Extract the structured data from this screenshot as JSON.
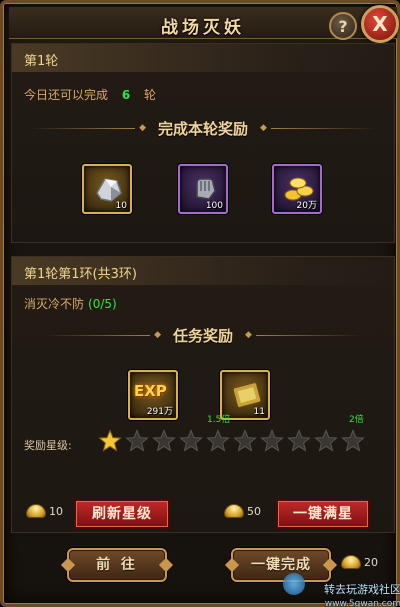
{
  "window": {
    "title": "战场灭妖",
    "help_label": "?",
    "close_label": "X"
  },
  "round": {
    "header": "第1轮",
    "today_prefix": "今日还可以完成",
    "today_count": "6",
    "today_suffix": "轮",
    "section_title": "完成本轮奖励",
    "rewards": [
      {
        "icon": "ore-icon",
        "qty": "10",
        "frame": "gold"
      },
      {
        "icon": "gauntlet-icon",
        "qty": "100",
        "frame": "purple"
      },
      {
        "icon": "coins-icon",
        "qty": "20万",
        "frame": "purple"
      }
    ]
  },
  "task": {
    "header": "第1轮第1环(共3环)",
    "name": "消灭冷不防",
    "progress": "(0/5)",
    "section_title": "任务奖励",
    "rewards": [
      {
        "icon": "exp-icon",
        "label": "EXP",
        "qty": "291万",
        "frame": "gold"
      },
      {
        "icon": "ticket-icon",
        "qty": "11",
        "frame": "gold"
      }
    ],
    "multiplier_mid": "1.5倍",
    "multiplier_max": "2倍",
    "stars_label": "奖励星级:",
    "stars_total": 10,
    "stars_filled": 1
  },
  "actions": {
    "refresh_cost": "10",
    "refresh_label": "刷新星级",
    "max_cost": "50",
    "max_label": "一键满星",
    "go_label": "前  往",
    "complete_label": "一键完成",
    "complete_cost": "20"
  },
  "watermark": {
    "text": "转去玩游戏社区",
    "url": "www.5qwan.com"
  },
  "colors": {
    "accent_green": "#35e53c",
    "gold_text": "#f0d39a",
    "button_red": "#c02a2a"
  }
}
